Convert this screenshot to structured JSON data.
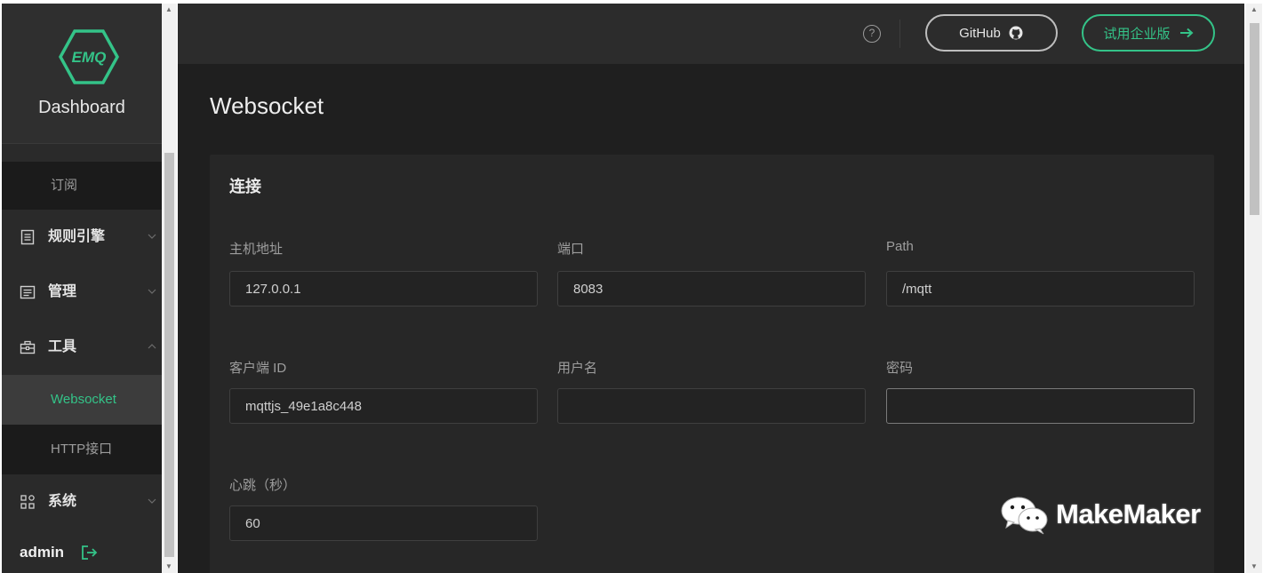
{
  "sidebar": {
    "logo_text": "EMQ",
    "brand_title": "Dashboard",
    "items": [
      {
        "label": "订阅",
        "type": "sub"
      },
      {
        "label": "规则引擎",
        "type": "group",
        "icon": "document-icon",
        "expanded": false
      },
      {
        "label": "管理",
        "type": "group",
        "icon": "list-icon",
        "expanded": false
      },
      {
        "label": "工具",
        "type": "group",
        "icon": "toolbox-icon",
        "expanded": true
      },
      {
        "label": "Websocket",
        "type": "sub",
        "active": true
      },
      {
        "label": "HTTP接口",
        "type": "sub"
      },
      {
        "label": "系统",
        "type": "group",
        "icon": "grid-icon",
        "expanded": false
      }
    ],
    "user": "admin"
  },
  "header": {
    "help_icon": "question-circle-icon",
    "github_label": "GitHub",
    "trial_label": "试用企业版"
  },
  "page": {
    "title": "Websocket",
    "card_title": "连接",
    "fields": {
      "host": {
        "label": "主机地址",
        "value": "127.0.0.1"
      },
      "port": {
        "label": "端口",
        "value": "8083"
      },
      "path": {
        "label": "Path",
        "value": "/mqtt"
      },
      "client_id": {
        "label": "客户端 ID",
        "value": "mqttjs_49e1a8c448"
      },
      "username": {
        "label": "用户名",
        "value": ""
      },
      "password": {
        "label": "密码",
        "value": ""
      },
      "keepalive": {
        "label": "心跳（秒）",
        "value": "60"
      }
    }
  },
  "watermark": {
    "text": "MakeMaker"
  },
  "colors": {
    "accent": "#34c388",
    "sidebar_bg": "#2a2a2a",
    "main_bg": "#1f1f1f"
  }
}
